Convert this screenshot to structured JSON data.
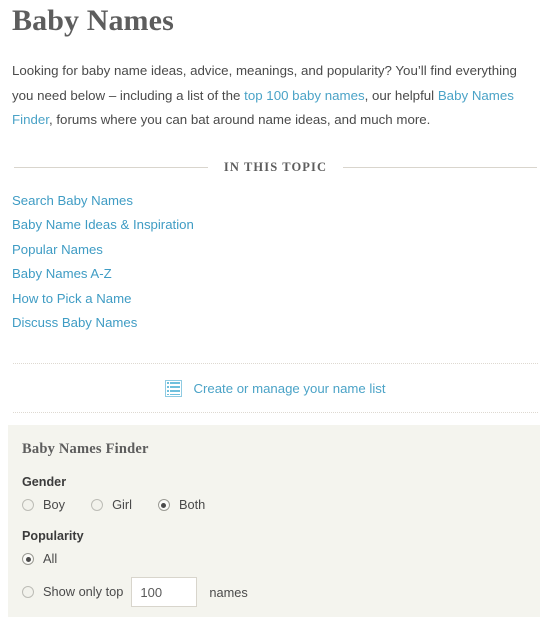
{
  "page": {
    "title": "Baby Names"
  },
  "intro": {
    "part1": "Looking for baby name ideas, advice, meanings, and popularity? You’ll find everything you need below – including a list of the ",
    "link1": "top 100 baby names",
    "part2": ", our helpful ",
    "link2": "Baby Names Finder",
    "part3": ", forums where you can bat around name ideas, and much more."
  },
  "topic": {
    "heading": "IN THIS TOPIC",
    "links": [
      {
        "label": "Search Baby Names"
      },
      {
        "label": "Baby Name Ideas & Inspiration"
      },
      {
        "label": "Popular Names"
      },
      {
        "label": "Baby Names A-Z"
      },
      {
        "label": "How to Pick a Name"
      },
      {
        "label": "Discuss Baby Names"
      }
    ]
  },
  "namelist": {
    "icon": "list-icon",
    "label": "Create or manage your name list"
  },
  "finder": {
    "title": "Baby Names Finder",
    "gender": {
      "label": "Gender",
      "options": [
        {
          "label": "Boy",
          "checked": false
        },
        {
          "label": "Girl",
          "checked": false
        },
        {
          "label": "Both",
          "checked": true
        }
      ]
    },
    "popularity": {
      "label": "Popularity",
      "all_option": {
        "label": "All",
        "checked": true
      },
      "top_option": {
        "label": "Show only top",
        "checked": false
      },
      "count_value": "100",
      "count_placeholder": "100",
      "suffix": "names"
    }
  },
  "colors": {
    "link": "#4ba3c7",
    "heading": "#5d5d5d",
    "panel_bg": "#f4f4ee",
    "rule": "#d9d5cd"
  }
}
